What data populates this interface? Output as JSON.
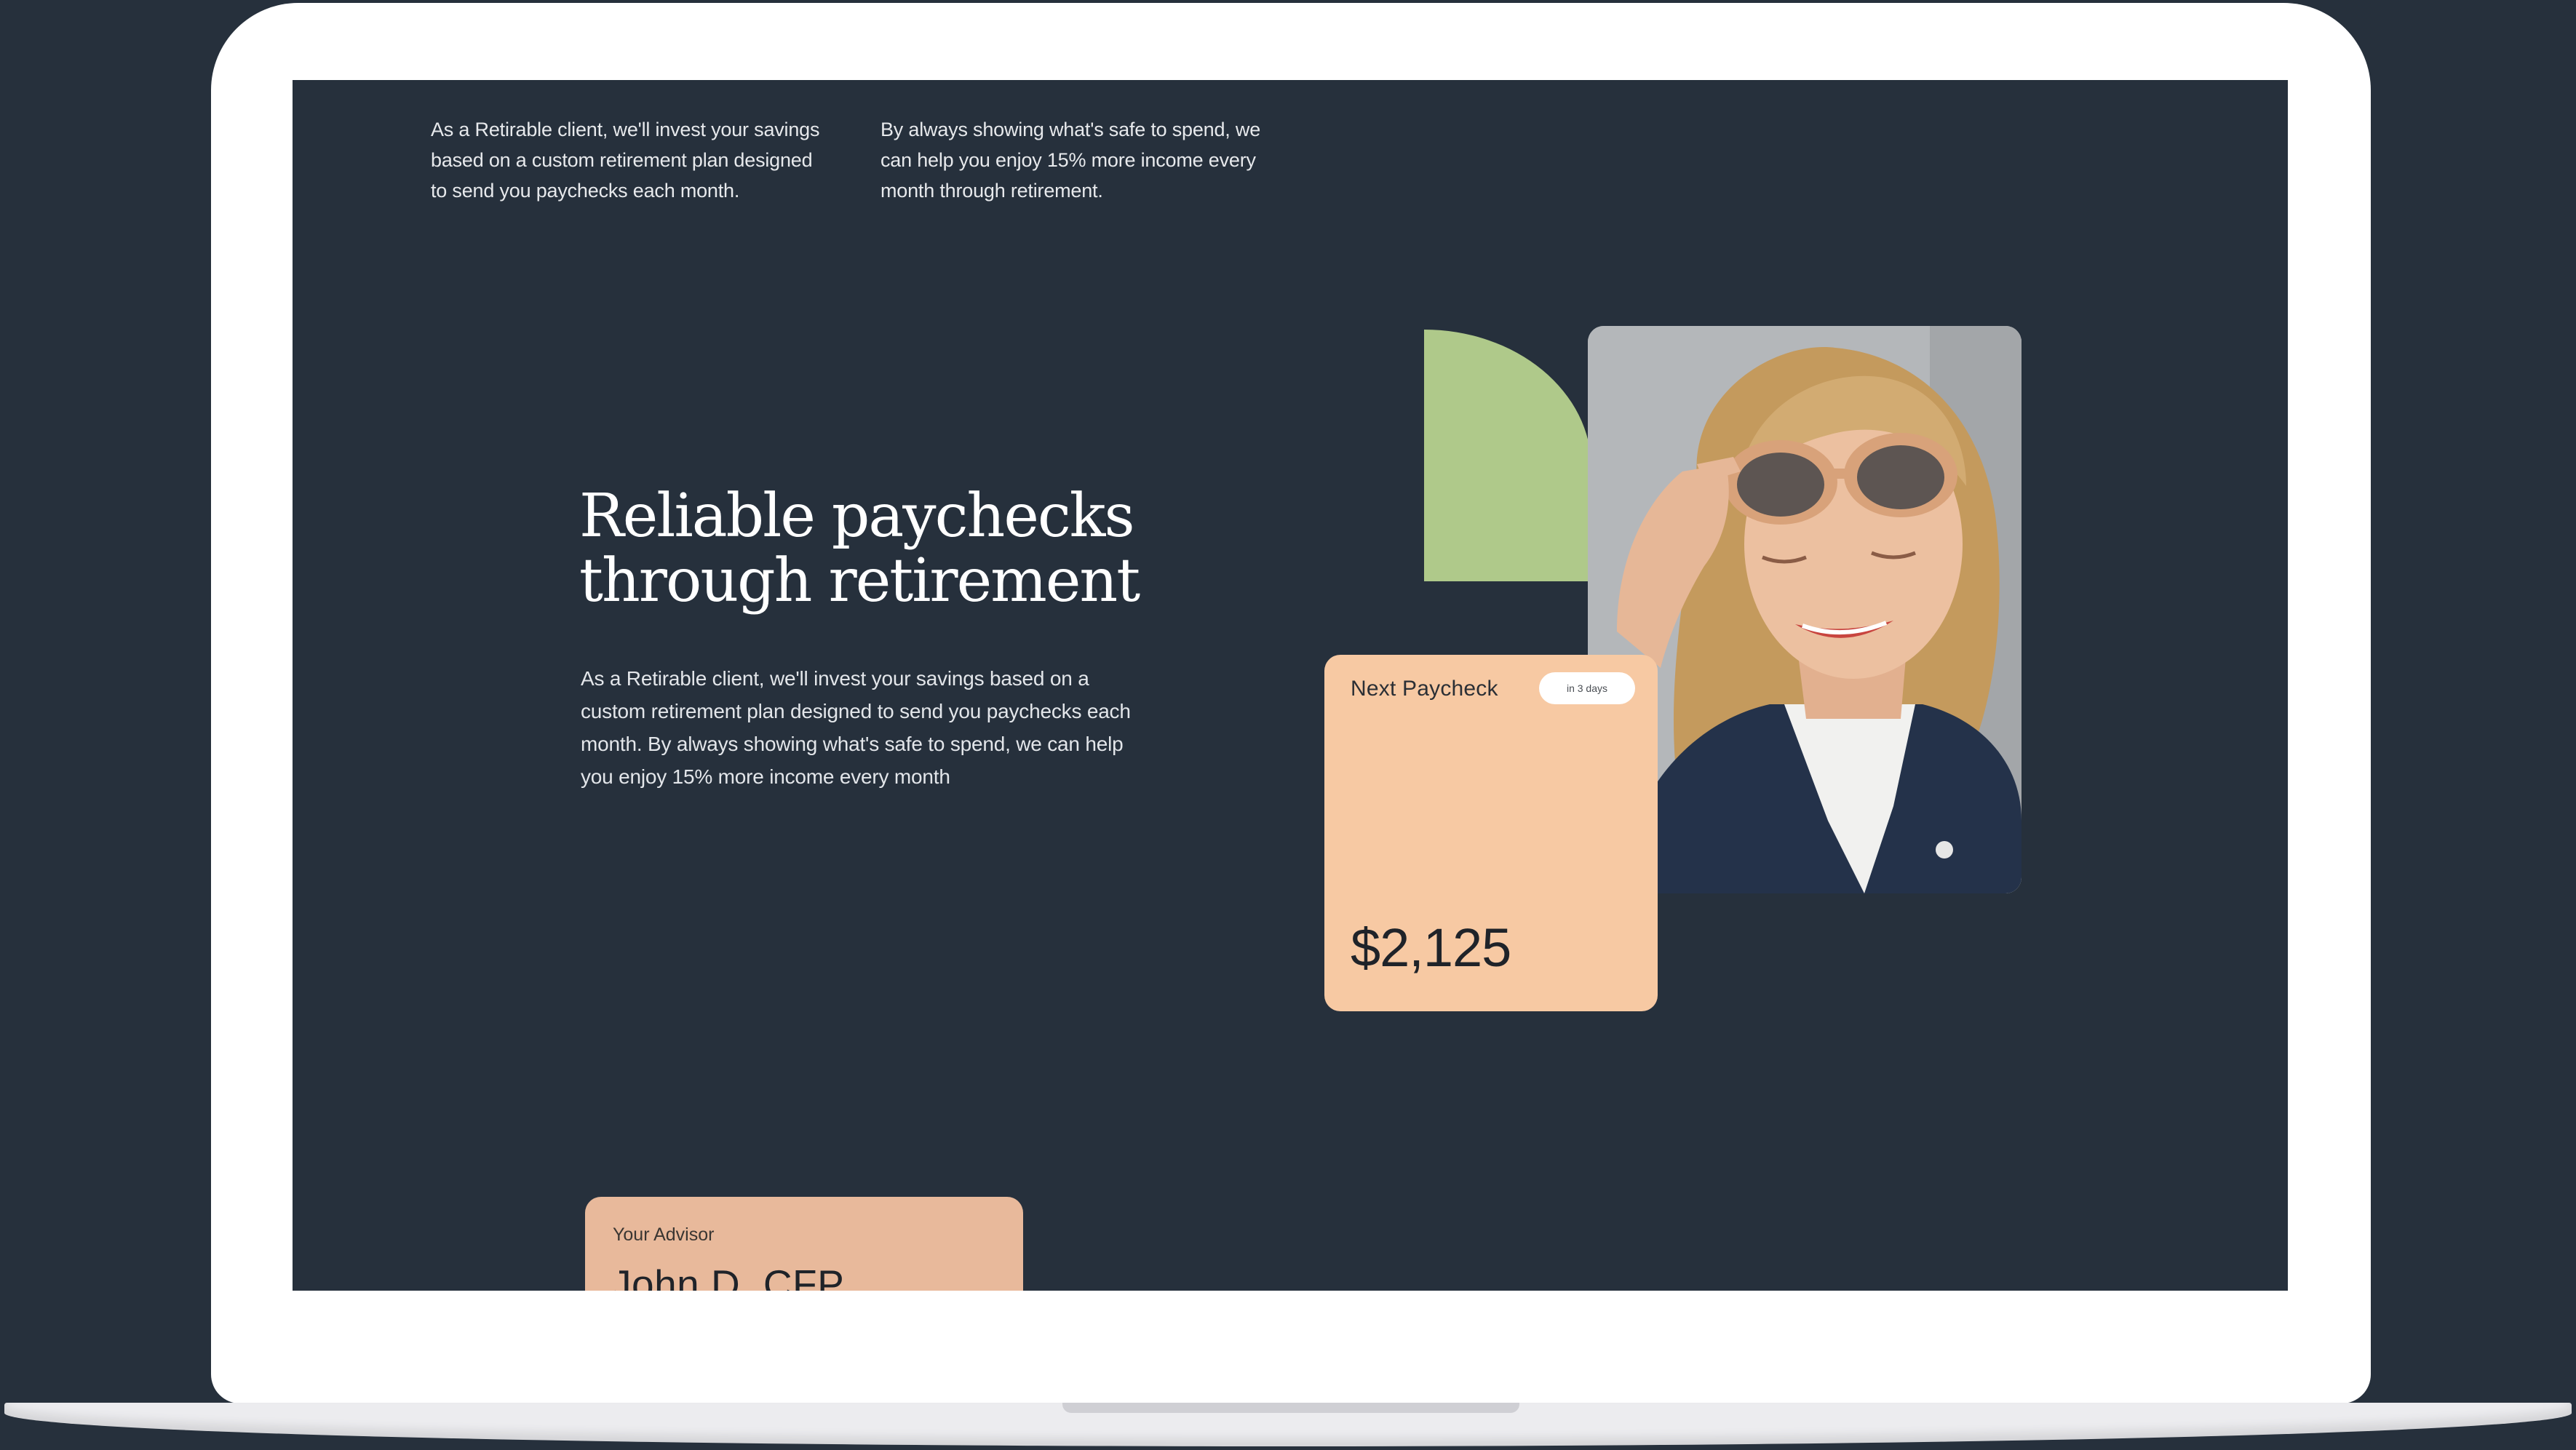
{
  "intro": {
    "column_1": "As a Retirable client, we'll invest your savings based on a custom retirement plan designed to send you paychecks each month.",
    "column_2": "By always showing what's safe to spend, we can help you enjoy 15% more income every month through retirement."
  },
  "hero": {
    "headline": "Reliable paychecks through retirement",
    "body": "As a Retirable client, we'll invest your savings based on a custom retirement plan designed to send you paychecks each month. By always showing what's safe to spend, we can help you enjoy 15% more income every month"
  },
  "paycheck_card": {
    "title": "Next Paycheck",
    "badge": "in 3 days",
    "amount": "$2,125"
  },
  "advisor_card": {
    "label": "Your Advisor",
    "name": "John D, CFP"
  },
  "colors": {
    "background": "#26303c",
    "laptop_frame": "#ffffff",
    "green_accent": "#afc98a",
    "paycheck_card": "#f7c9a3",
    "advisor_card": "#e8b99b"
  }
}
